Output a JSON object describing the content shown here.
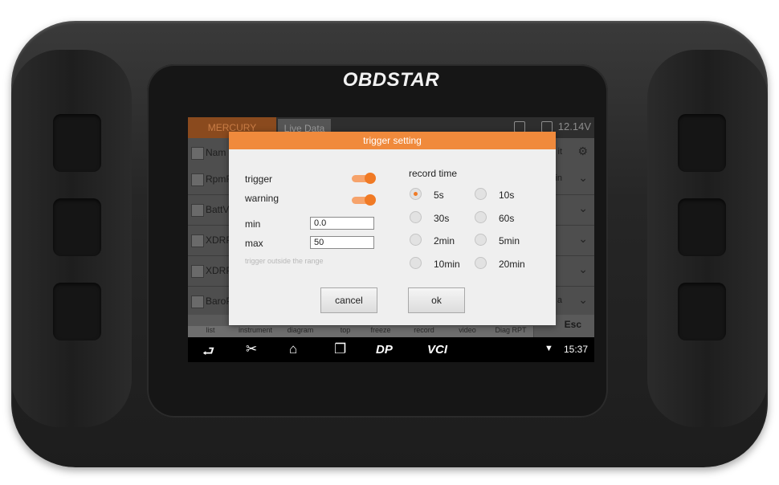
{
  "brand": {
    "logo": "OBDSTAR"
  },
  "status": {
    "voltage": "12.14V",
    "time": "15:37"
  },
  "tabs": [
    {
      "label": "MERCURY"
    },
    {
      "label": "Live Data"
    }
  ],
  "table": {
    "header": "Nam",
    "rows": [
      {
        "label": "RpmF",
        "right": "in"
      },
      {
        "label": "BattV",
        "right": ""
      },
      {
        "label": "XDRP",
        "right": ""
      },
      {
        "label": "XDRP",
        "right": ""
      },
      {
        "label": "BaroP",
        "right": "a"
      }
    ],
    "header_right": "it"
  },
  "function_bar": {
    "items": [
      "list",
      "instrument",
      "diagram",
      "top",
      "freeze",
      "record",
      "video",
      "Diag RPT"
    ],
    "esc": "Esc"
  },
  "navbar": {
    "dp": "DP",
    "vci": "VCI"
  },
  "dialog": {
    "title": "trigger setting",
    "trigger_label": "trigger",
    "trigger_on": true,
    "warning_label": "warning",
    "warning_on": true,
    "min_label": "min",
    "min_value": "0.0",
    "max_label": "max",
    "max_value": "50",
    "hint": "trigger outside the range",
    "record_time_label": "record time",
    "record_options": [
      "5s",
      "10s",
      "30s",
      "60s",
      "2min",
      "5min",
      "10min",
      "20min"
    ],
    "selected": "5s",
    "cancel": "cancel",
    "ok": "ok"
  },
  "colors": {
    "accent": "#f08a3c",
    "brand_tab": "#8a4a1e"
  }
}
